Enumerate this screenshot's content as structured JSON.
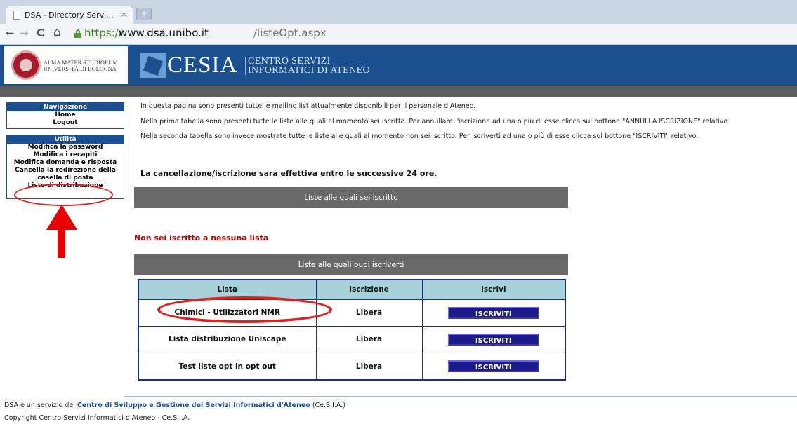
{
  "browser": {
    "tab_title": "DSA - Directory Servi...",
    "tab_close": "×",
    "new_tab": "+",
    "back": "←",
    "forward": "→",
    "reload": "C",
    "home": "⌂",
    "url_scheme": "https://",
    "url_host": "www.dsa.unibo.it",
    "url_path": "/listeOpt.aspx"
  },
  "header": {
    "unibo_line1": "ALMA MATER STUDIORUM",
    "unibo_line2": "UNIVERSITÀ DI BOLOGNA",
    "cesia_word": "CESIA",
    "cesia_sub1": "CENTRO SERVIZI",
    "cesia_sub2": "INFORMATICI DI ATENEO",
    "brand_color": "#1a4f90"
  },
  "sidebar": {
    "nav_title": "Navigazione",
    "nav_items": [
      "Home",
      "Logout"
    ],
    "util_title": "Utilità",
    "util_items": [
      "Modifica la password",
      "Modifica i recapiti",
      "Modifica domanda e risposta",
      "Cancella la redirezione della",
      "casella di posta",
      "Liste di distribuzione"
    ]
  },
  "main": {
    "intro1": "In questa pagina sono presenti tutte le mailing list attualmente disponibili per il personale d'Ateneo.",
    "intro2": "Nella prima tabella sono presenti tutte le liste alle quali al momento sei iscritto. Per annullare l'iscrizione ad una o più di esse clicca sul bottone \"ANNULLA ISCRIZIONE\" relativo.",
    "intro3": "Nella seconda tabella sono invece mostrate tutte le liste alle quali al momento non sei iscritto. Per iscriverti ad una o più di esse clicca sul bottone \"ISCRIVITI\" relativo.",
    "notice": "La cancellazione/iscrizione sarà effettiva entro le successive 24 ore.",
    "subscribed_header": "Liste alle quali sei iscritto",
    "no_list": "Non sei iscritto a nessuna lista",
    "available_header": "Liste alle quali puoi iscriverti",
    "table": {
      "columns": [
        "Lista",
        "Iscrizione",
        "Iscrivi"
      ],
      "rows": [
        {
          "lista": "Chimici - Utilizzatori NMR",
          "iscrizione": "Libera",
          "button": "ISCRIVITI"
        },
        {
          "lista": "Lista distribuzione Uniscape",
          "iscrizione": "Libera",
          "button": "ISCRIVITI"
        },
        {
          "lista": "Test liste opt in opt out",
          "iscrizione": "Libera",
          "button": "ISCRIVITI"
        }
      ]
    }
  },
  "footer": {
    "line1_prefix": "DSA è un servizio del",
    "line1_link": "Centro di Sviluppo e Gestione dei Servizi Informatici d'Ateneo",
    "line1_suffix": "(Ce.S.I.A.)",
    "line2": "Copyright Centro Servizi Informatici d'Ateneo - Ce.S.I.A."
  }
}
